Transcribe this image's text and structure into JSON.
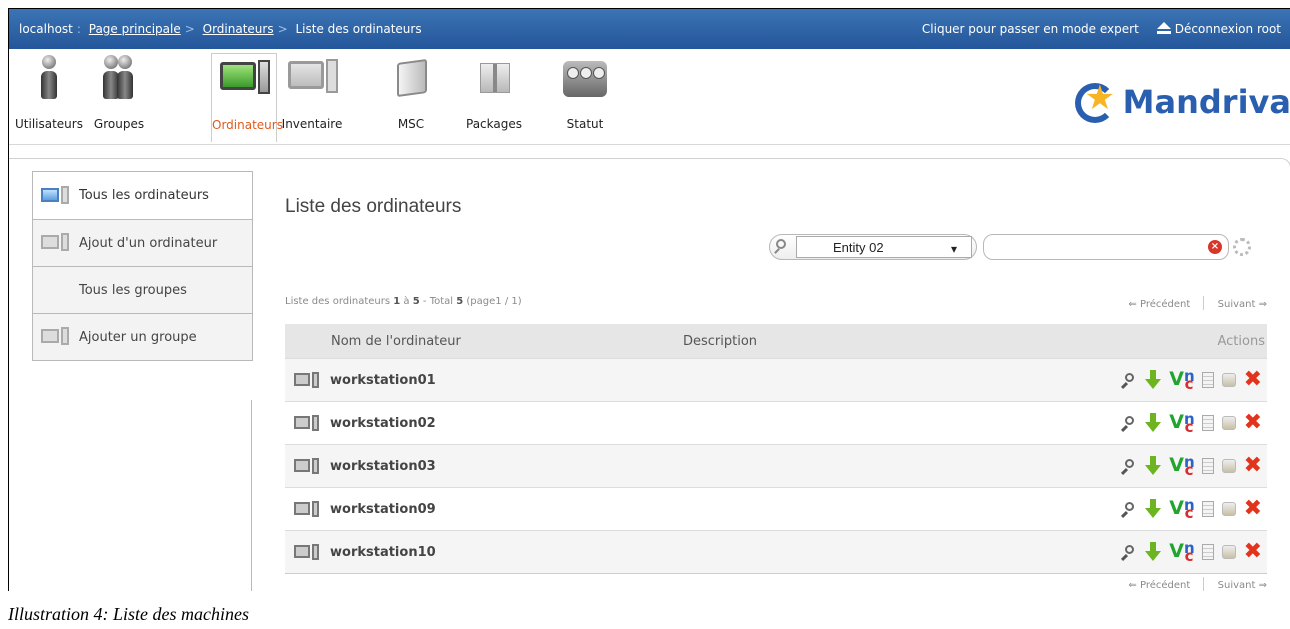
{
  "topbar": {
    "host": "localhost",
    "home": "Page principale",
    "computers": "Ordinateurs",
    "current": "Liste des ordinateurs",
    "expert": "Cliquer pour passer en mode expert",
    "logout": "Déconnexion root"
  },
  "nav": {
    "items": [
      {
        "label": "Utilisateurs",
        "icon": "user-icon"
      },
      {
        "label": "Groupes",
        "icon": "group-icon"
      },
      {
        "label": "Ordinateurs",
        "icon": "computer-icon",
        "active": true
      },
      {
        "label": "Inventaire",
        "icon": "inventory-icon"
      },
      {
        "label": "MSC",
        "icon": "msc-icon"
      },
      {
        "label": "Packages",
        "icon": "package-icon"
      },
      {
        "label": "Statut",
        "icon": "status-icon"
      }
    ],
    "logo": "Mandriva"
  },
  "sidebar": {
    "items": [
      {
        "label": "Tous les ordinateurs"
      },
      {
        "label": "Ajout d'un ordinateur"
      },
      {
        "label": "Tous les groupes"
      },
      {
        "label": "Ajouter un groupe"
      }
    ]
  },
  "main": {
    "title": "Liste des ordinateurs",
    "entity": "Entity 02",
    "search_value": "",
    "summary": {
      "prefix": "Liste des ordinateurs",
      "from": "1",
      "sep1": "à",
      "to": "5",
      "mid": "- Total",
      "total": "5",
      "page_prefix": "(page",
      "page": "1 / 1",
      "page_suffix": ")"
    },
    "prev": "Précédent",
    "next": "Suivant",
    "columns": {
      "name": "Nom de l'ordinateur",
      "description": "Description",
      "actions": "Actions"
    },
    "rows": [
      {
        "name": "workstation01",
        "description": ""
      },
      {
        "name": "workstation02",
        "description": ""
      },
      {
        "name": "workstation03",
        "description": ""
      },
      {
        "name": "workstation09",
        "description": ""
      },
      {
        "name": "workstation10",
        "description": ""
      }
    ],
    "action_icons": {
      "vnc_v": "V",
      "vnc_n": "n",
      "vnc_c": "c",
      "delete": "✖"
    }
  },
  "caption": "Illustration 4: Liste des machines",
  "colors": {
    "topbar": "#2f65a8",
    "active_tab": "#e05a1b",
    "logo": "#2a5fb0"
  }
}
